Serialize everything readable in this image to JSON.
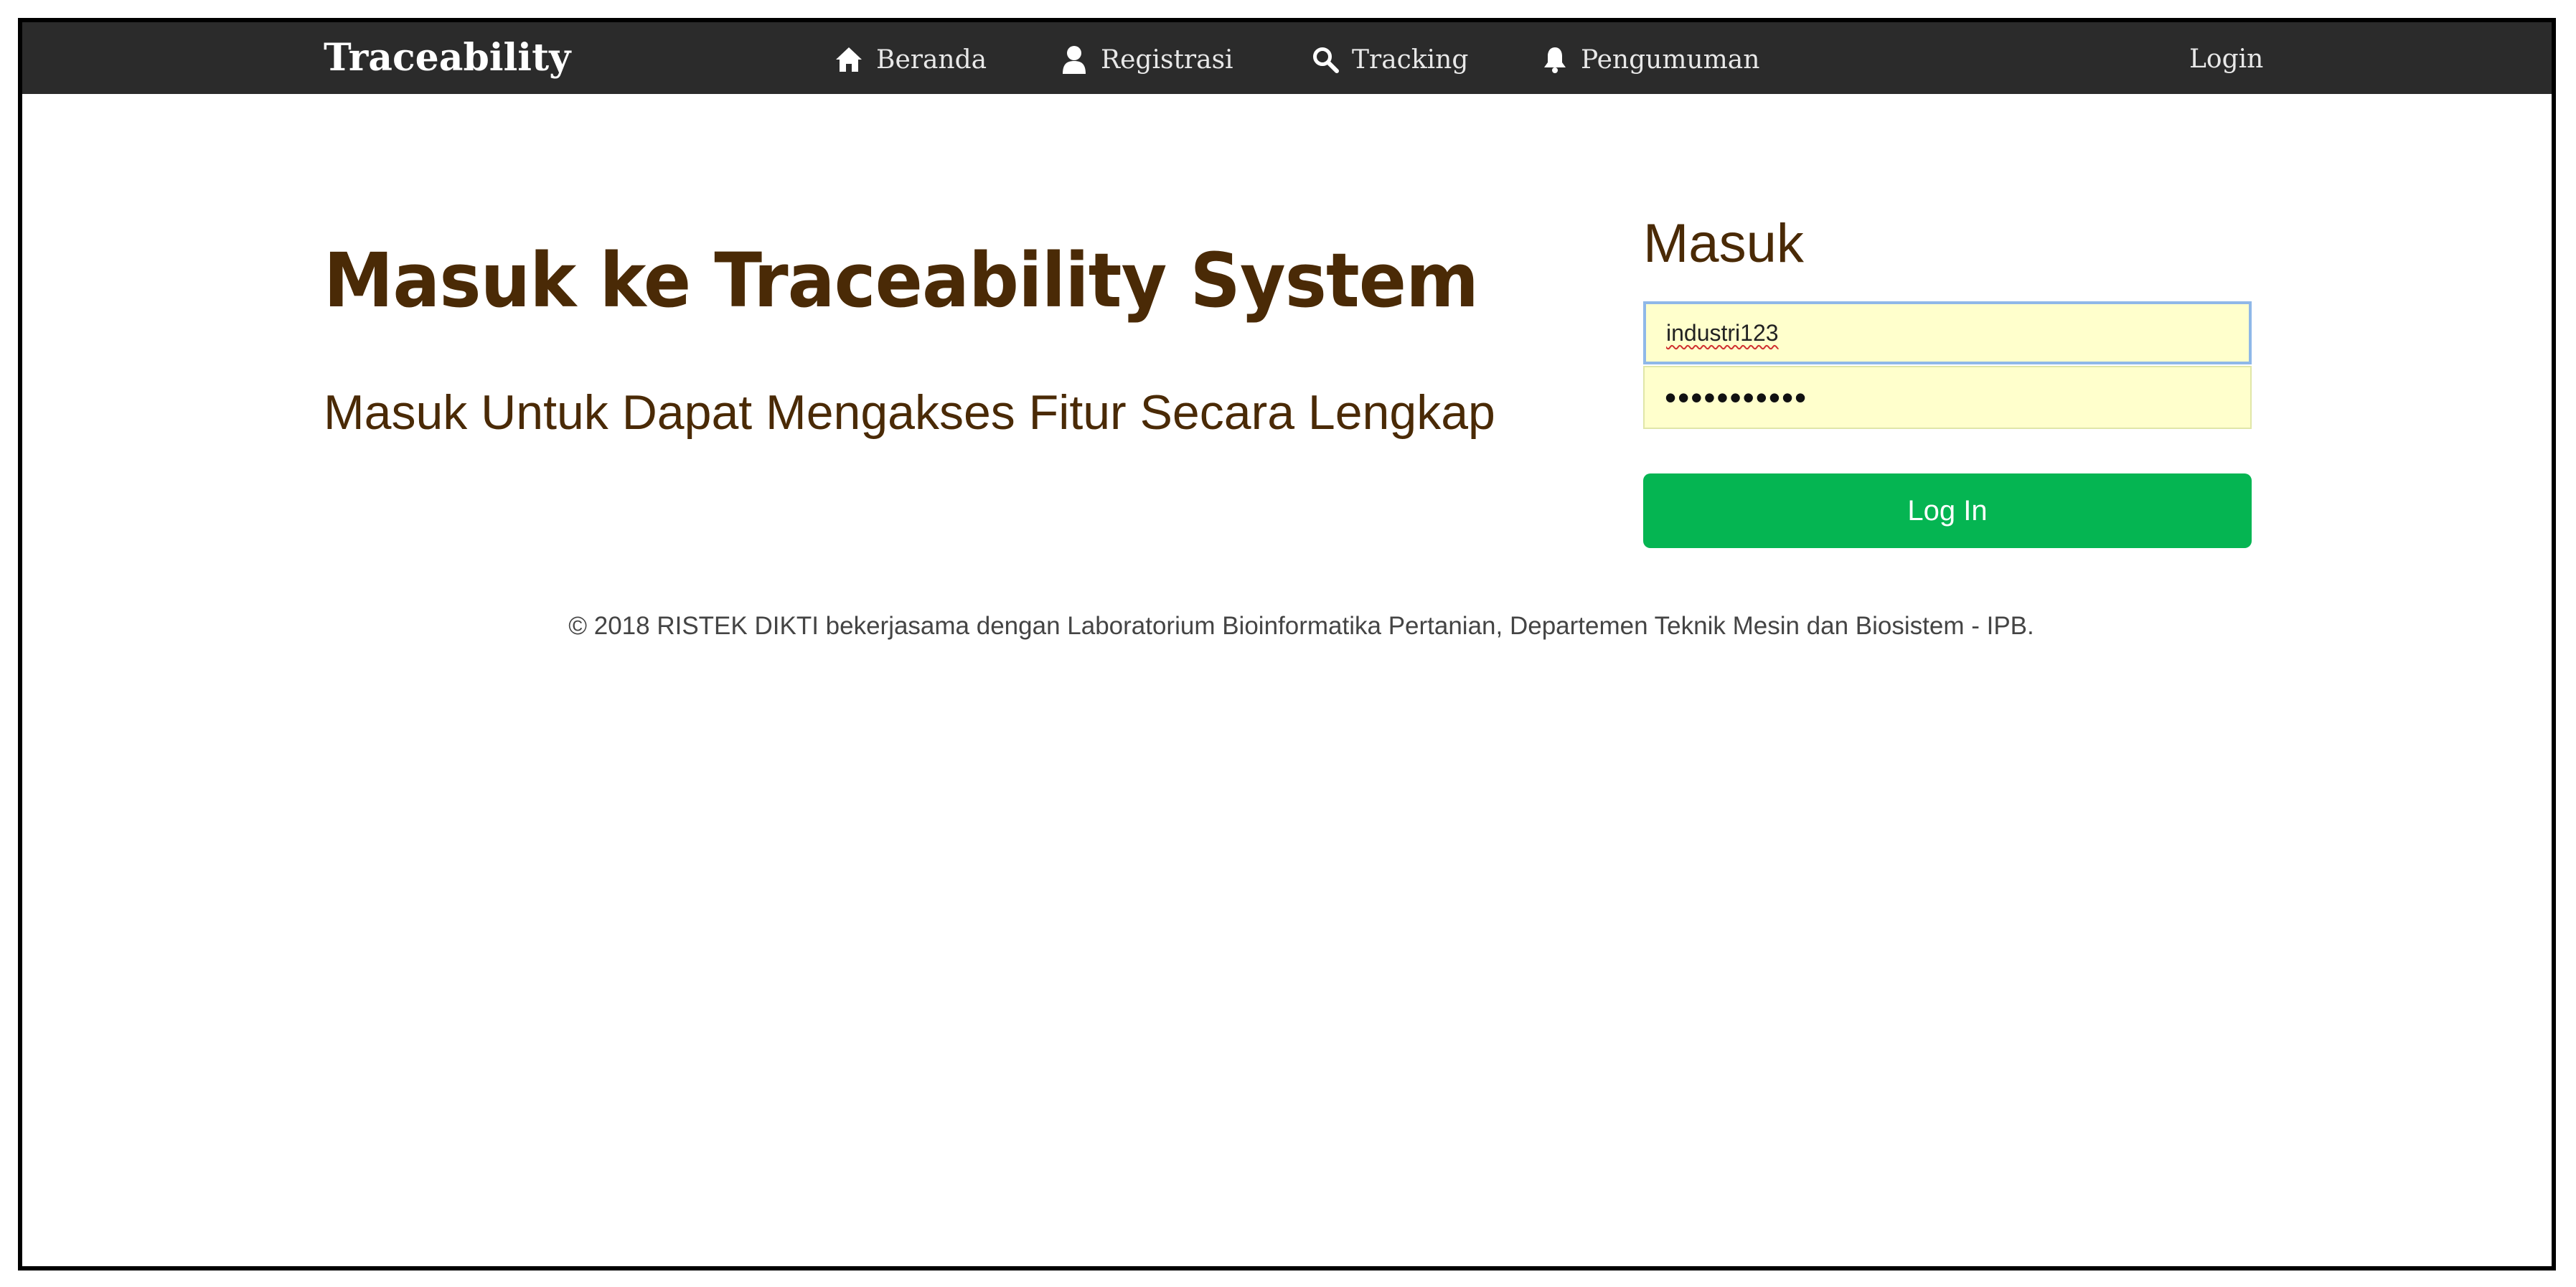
{
  "navbar": {
    "brand": "Traceability",
    "items": [
      {
        "label": "Beranda",
        "icon": "home-icon"
      },
      {
        "label": "Registrasi",
        "icon": "user-icon"
      },
      {
        "label": "Tracking",
        "icon": "search-icon"
      },
      {
        "label": "Pengumuman",
        "icon": "bell-icon"
      }
    ],
    "login_label": "Login",
    "background": "#2b2b2b"
  },
  "hero": {
    "title": "Masuk ke Traceability System",
    "subtitle": "Masuk Untuk Dapat Mengakses Fitur Secara Lengkap",
    "text_color": "#4a2a06"
  },
  "login_form": {
    "title": "Masuk",
    "username_value": "industri123",
    "password_masked": "•••••••••••",
    "submit_label": "Log In",
    "button_color": "#05b552",
    "field_background": "#ffffcc"
  },
  "footer": {
    "text": "© 2018 RISTEK DIKTI bekerjasama dengan Laboratorium Bioinformatika Pertanian, Departemen Teknik Mesin dan Biosistem - IPB."
  }
}
